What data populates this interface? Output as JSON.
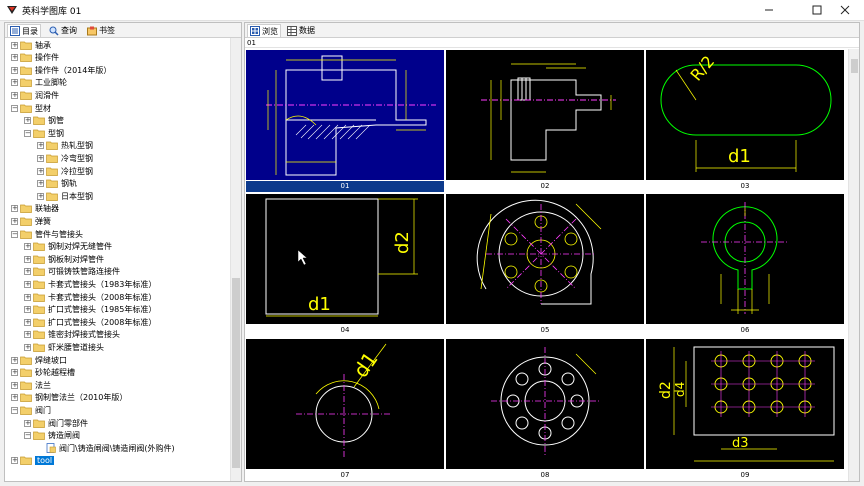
{
  "window": {
    "title": "英科学图库 01"
  },
  "left_tabs": [
    {
      "label": "目录"
    },
    {
      "label": "查询"
    },
    {
      "label": "书签"
    }
  ],
  "tree": [
    {
      "label": "轴承",
      "level": 0,
      "expanded": false
    },
    {
      "label": "操作件",
      "level": 0,
      "expanded": false
    },
    {
      "label": "操作件（2014年版）",
      "level": 0,
      "expanded": false
    },
    {
      "label": "工业脚轮",
      "level": 0,
      "expanded": false
    },
    {
      "label": "润滑件",
      "level": 0,
      "expanded": false
    },
    {
      "label": "型材",
      "level": 0,
      "expanded": true
    },
    {
      "label": "钢管",
      "level": 1,
      "expanded": false
    },
    {
      "label": "型钢",
      "level": 1,
      "expanded": true
    },
    {
      "label": "热轧型钢",
      "level": 2,
      "expanded": false
    },
    {
      "label": "冷弯型钢",
      "level": 2,
      "expanded": false
    },
    {
      "label": "冷拉型钢",
      "level": 2,
      "expanded": false
    },
    {
      "label": "钢轨",
      "level": 2,
      "expanded": false
    },
    {
      "label": "日本型钢",
      "level": 2,
      "expanded": false
    },
    {
      "label": "联轴器",
      "level": 0,
      "expanded": false
    },
    {
      "label": "弹簧",
      "level": 0,
      "expanded": false
    },
    {
      "label": "管件与管接头",
      "level": 0,
      "expanded": true
    },
    {
      "label": "钢制对焊无缝管件",
      "level": 1,
      "expanded": false
    },
    {
      "label": "钢板制对焊管件",
      "level": 1,
      "expanded": false
    },
    {
      "label": "可锻铸铁管路连接件",
      "level": 1,
      "expanded": false
    },
    {
      "label": "卡套式管接头（1983年标准）",
      "level": 1,
      "expanded": false
    },
    {
      "label": "卡套式管接头（2008年标准）",
      "level": 1,
      "expanded": false
    },
    {
      "label": "扩口式管接头（1985年标准）",
      "level": 1,
      "expanded": false
    },
    {
      "label": "扩口式管接头（2008年标准）",
      "level": 1,
      "expanded": false
    },
    {
      "label": "锥密封焊接式管接头",
      "level": 1,
      "expanded": false
    },
    {
      "label": "虾米腰管道接头",
      "level": 1,
      "expanded": false
    },
    {
      "label": "焊缝坡口",
      "level": 0,
      "expanded": false
    },
    {
      "label": "砂轮越程槽",
      "level": 0,
      "expanded": false
    },
    {
      "label": "法兰",
      "level": 0,
      "expanded": false
    },
    {
      "label": "钢制管法兰（2010年版）",
      "level": 0,
      "expanded": false
    },
    {
      "label": "阀门",
      "level": 0,
      "expanded": true
    },
    {
      "label": "阀门零部件",
      "level": 1,
      "expanded": false
    },
    {
      "label": "铸造闸阀",
      "level": 1,
      "expanded": true
    },
    {
      "label": "阀门\\铸造闸阀\\铸造闸阀(外购件)",
      "level": 2,
      "leaf": true
    },
    {
      "label": "tool",
      "level": 0,
      "expanded": false,
      "selected": true
    }
  ],
  "right_tabs": [
    {
      "label": "浏览"
    },
    {
      "label": "数据"
    }
  ],
  "path": "01",
  "thumbnails": [
    {
      "caption": "01",
      "selected": true
    },
    {
      "caption": "02",
      "selected": false
    },
    {
      "caption": "03",
      "selected": false
    },
    {
      "caption": "04",
      "selected": false
    },
    {
      "caption": "05",
      "selected": false
    },
    {
      "caption": "06",
      "selected": false
    },
    {
      "caption": "07",
      "selected": false
    },
    {
      "caption": "08",
      "selected": false
    },
    {
      "caption": "09",
      "selected": false
    }
  ],
  "drawing_labels": {
    "r2": "R/2",
    "d1": "d1",
    "d2": "d2",
    "d3": "d3",
    "d4": "d4"
  },
  "colors": {
    "selection": "#0078d7",
    "caption_selected": "#0c3a8c",
    "drawing_bg": "#000000",
    "drawing_bg_selected": "#00008b"
  }
}
